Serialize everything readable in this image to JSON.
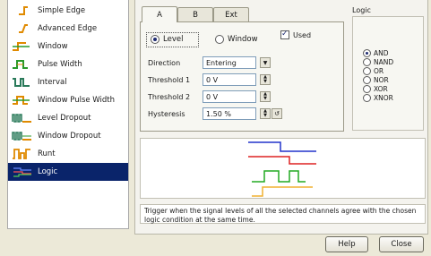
{
  "sidebar": {
    "items": [
      {
        "label": "Simple Edge",
        "icon": "simple-edge-icon"
      },
      {
        "label": "Advanced Edge",
        "icon": "advanced-edge-icon"
      },
      {
        "label": "Window",
        "icon": "window-icon"
      },
      {
        "label": "Pulse Width",
        "icon": "pulse-width-icon"
      },
      {
        "label": "Interval",
        "icon": "interval-icon"
      },
      {
        "label": "Window Pulse Width",
        "icon": "window-pulse-width-icon"
      },
      {
        "label": "Level Dropout",
        "icon": "level-dropout-icon"
      },
      {
        "label": "Window Dropout",
        "icon": "window-dropout-icon"
      },
      {
        "label": "Runt",
        "icon": "runt-icon"
      },
      {
        "label": "Logic",
        "icon": "logic-icon",
        "selected": true
      }
    ]
  },
  "tabs": [
    "A",
    "B",
    "Ext"
  ],
  "active_tab": "A",
  "mode": {
    "level_label": "Level",
    "window_label": "Window",
    "selected": "Level"
  },
  "used": {
    "label": "Used",
    "checked": true
  },
  "direction": {
    "label": "Direction",
    "value": "Entering"
  },
  "threshold1": {
    "label": "Threshold 1",
    "value": "0 V"
  },
  "threshold2": {
    "label": "Threshold 2",
    "value": "0 V"
  },
  "hysteresis": {
    "label": "Hysteresis",
    "value": "1.50 %"
  },
  "logic": {
    "title": "Logic",
    "options": [
      "AND",
      "NAND",
      "OR",
      "NOR",
      "XOR",
      "XNOR"
    ],
    "selected": "AND"
  },
  "preview_colors": {
    "a": "#2233cc",
    "b": "#dd2222",
    "c": "#22aa22",
    "d": "#f0b030"
  },
  "description": "Trigger when the signal levels of all the selected channels agree with the chosen logic condition at the same time.",
  "buttons": {
    "help": "Help",
    "close": "Close"
  }
}
